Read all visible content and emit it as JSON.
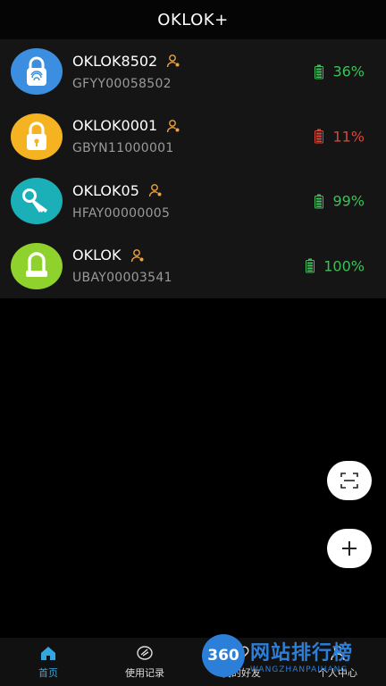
{
  "header": {
    "title": "OKLOK+"
  },
  "devices": [
    {
      "name": "OKLOK8502",
      "code": "GFYY00058502",
      "battery": "36%",
      "battery_color": "#3fbf5a",
      "avatar_color": "#3c8fe0",
      "icon": "fingerprint-lock-icon"
    },
    {
      "name": "OKLOK0001",
      "code": "GBYN11000001",
      "battery": "11%",
      "battery_color": "#d9453a",
      "avatar_color": "#f5b321",
      "icon": "padlock-icon"
    },
    {
      "name": "OKLOK05",
      "code": "HFAY00000005",
      "battery": "99%",
      "battery_color": "#3fbf5a",
      "avatar_color": "#1bb0b8",
      "icon": "key-icon"
    },
    {
      "name": "OKLOK",
      "code": "UBAY00003541",
      "battery": "100%",
      "battery_color": "#3fbf5a",
      "avatar_color": "#8fd12d",
      "icon": "u-lock-icon"
    }
  ],
  "tabs": [
    {
      "label": "首页",
      "icon": "home-icon"
    },
    {
      "label": "使用记录",
      "icon": "record-icon"
    },
    {
      "label": "我的好友",
      "icon": "friends-icon"
    },
    {
      "label": "个人中心",
      "icon": "profile-icon"
    }
  ],
  "watermark": {
    "badge": "360",
    "main": "网站排行榜",
    "sub": "WANGZHANPAIHANG"
  },
  "colors": {
    "accent": "#33a8e0",
    "owner_icon": "#f0a23c"
  }
}
